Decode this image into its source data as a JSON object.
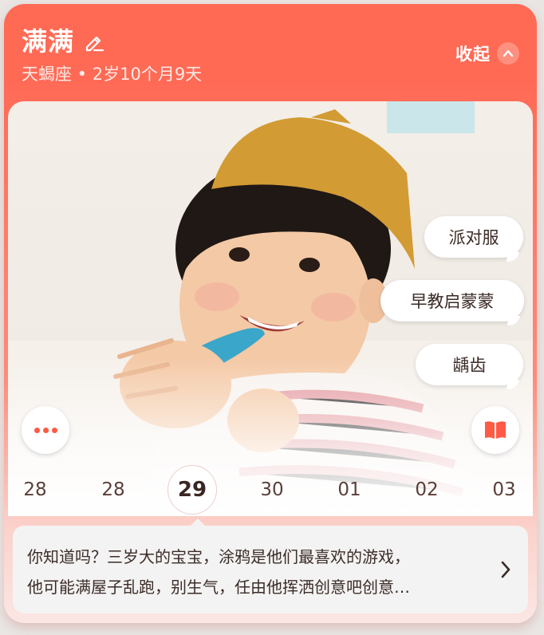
{
  "header": {
    "name": "满满",
    "subtitle": "天蝎座 • 2岁10个月9天",
    "collapse_label": "收起"
  },
  "tags": [
    "派对服",
    "早教启蒙蒙",
    "龋齿"
  ],
  "dates": [
    "28",
    "28",
    "29",
    "30",
    "01",
    "02",
    "03"
  ],
  "selected_date_index": 2,
  "tip": {
    "line1": "你知道吗？三岁大的宝宝，涂鸦是他们最喜欢的游戏，",
    "line2": "他可能满屋子乱跑，别生气，任由他挥洒创意吧创意…"
  },
  "colors": {
    "accent": "#ff5a45",
    "header": "#ff6a55"
  },
  "icons": {
    "edit": "edit-icon",
    "collapse": "chevron-up-icon",
    "more": "more-dots-icon",
    "book": "book-icon",
    "next": "chevron-right-icon"
  }
}
